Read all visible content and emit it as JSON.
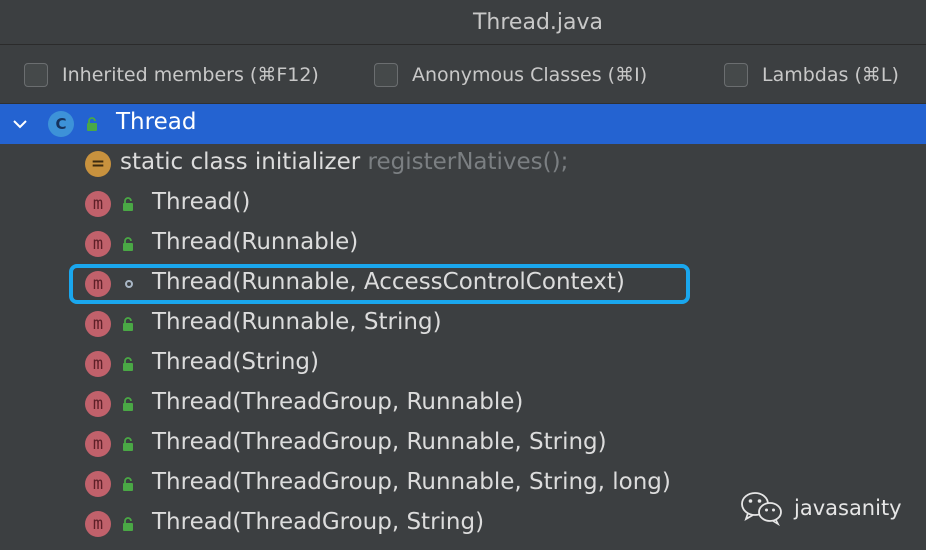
{
  "window": {
    "title": "Thread.java"
  },
  "options": [
    {
      "label": "Inherited members (⌘F12)",
      "checked": false
    },
    {
      "label": "Anonymous Classes (⌘I)",
      "checked": false
    },
    {
      "label": "Lambdas (⌘L)",
      "checked": false
    }
  ],
  "tree": {
    "root": {
      "label": "Thread",
      "badge": "C",
      "icon": "class-icon",
      "expanded": true,
      "selected": true
    },
    "items": [
      {
        "label": "static class initializer",
        "hint": "registerNatives();",
        "badge": "=",
        "icon": "static-initializer-icon",
        "visibility": "none"
      },
      {
        "label": "Thread()",
        "badge": "m",
        "icon": "method-icon",
        "visibility": "public"
      },
      {
        "label": "Thread(Runnable)",
        "badge": "m",
        "icon": "method-icon",
        "visibility": "public"
      },
      {
        "label": "Thread(Runnable, AccessControlContext)",
        "badge": "m",
        "icon": "method-icon",
        "visibility": "package-private",
        "highlighted": true
      },
      {
        "label": "Thread(Runnable, String)",
        "badge": "m",
        "icon": "method-icon",
        "visibility": "public"
      },
      {
        "label": "Thread(String)",
        "badge": "m",
        "icon": "method-icon",
        "visibility": "public"
      },
      {
        "label": "Thread(ThreadGroup, Runnable)",
        "badge": "m",
        "icon": "method-icon",
        "visibility": "public"
      },
      {
        "label": "Thread(ThreadGroup, Runnable, String)",
        "badge": "m",
        "icon": "method-icon",
        "visibility": "public"
      },
      {
        "label": "Thread(ThreadGroup, Runnable, String, long)",
        "badge": "m",
        "icon": "method-icon",
        "visibility": "public"
      },
      {
        "label": "Thread(ThreadGroup, String)",
        "badge": "m",
        "icon": "method-icon",
        "visibility": "public"
      }
    ]
  },
  "watermark": {
    "text": "javasanity",
    "icon": "wechat-icon"
  },
  "colors": {
    "background": "#3c3f41",
    "selection": "#2463d1",
    "highlight_border": "#1aa7ee",
    "class_badge": "#3d92d8",
    "method_badge": "#c1616b",
    "initializer_badge": "#c8923e",
    "public_lock": "#4aa845"
  }
}
